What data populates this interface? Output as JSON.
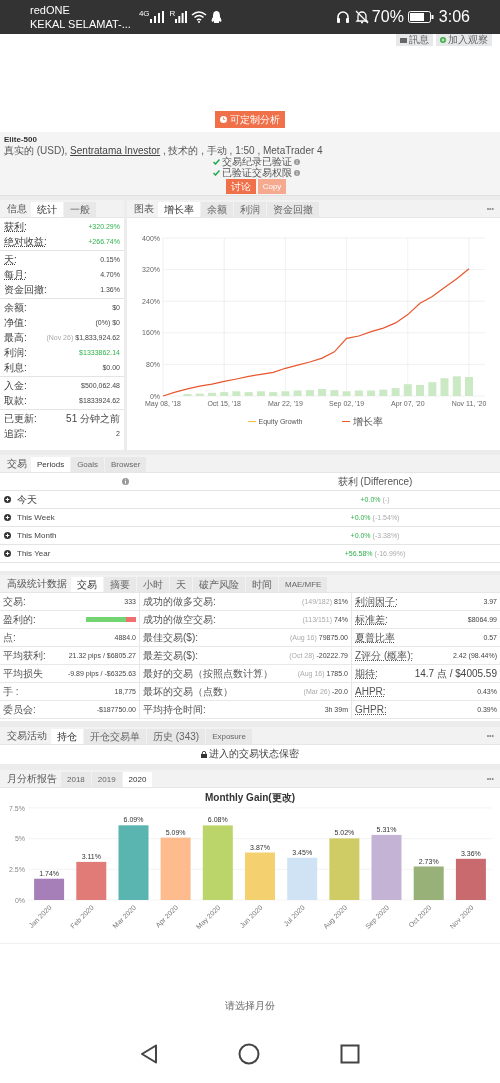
{
  "status_bar": {
    "carrier": "redONE",
    "operator": "KEKAL SELAMAT-...",
    "network_type": "4G",
    "sim2_label": "R",
    "battery": "70%",
    "time": "3:06"
  },
  "top_buttons": [
    {
      "label": "訊息"
    },
    {
      "label": "加入观察"
    }
  ],
  "analysis_button": "可定制分析",
  "account": {
    "name": "Elite-500",
    "type": "真实的 (USD),",
    "broker": "Sentratama Investor",
    "details": ", 技术的 , 手动 , 1:50 , MetaTrader 4",
    "verifications": [
      "交易纪录已验证",
      "已验证交易权限"
    ],
    "buttons": [
      {
        "label": "讨论",
        "disabled": false
      },
      {
        "label": "Copy",
        "disabled": true
      }
    ]
  },
  "stats": {
    "title": "信息",
    "tabs": [
      {
        "label": "统计",
        "selected": true
      },
      {
        "label": "一般",
        "selected": false
      }
    ],
    "groups": [
      [
        {
          "label": "获利:",
          "value": "+320.29%",
          "positive": true,
          "underlined": true
        },
        {
          "label": "绝对收益:",
          "value": "+266.74%",
          "positive": true,
          "underlined": true
        }
      ],
      [
        {
          "label": "天:",
          "value": "0.15%",
          "positive": false,
          "underlined": true
        },
        {
          "label": "每月:",
          "value": "4.70%",
          "positive": false,
          "underlined": true
        },
        {
          "label": "资金回撤:",
          "value": "1.36%",
          "positive": false,
          "underlined": false
        }
      ],
      [
        {
          "label": "余额:",
          "value": "$0",
          "positive": false,
          "underlined": false
        },
        {
          "label": "净值:",
          "value": "(0%) $0",
          "positive": false,
          "underlined": false
        },
        {
          "label": "最高:",
          "note": "(Nov 26)",
          "value": "$1,833,924.62",
          "positive": false,
          "underlined": false
        },
        {
          "label": "利润:",
          "value": "$1333862.14",
          "positive": true,
          "underlined": false
        },
        {
          "label": "利息:",
          "value": "$0.00",
          "positive": false,
          "underlined": false
        }
      ],
      [
        {
          "label": "入金:",
          "value": "$500,062.48",
          "positive": false,
          "underlined": false
        },
        {
          "label": "取款:",
          "value": "$1833924.62",
          "positive": false,
          "underlined": false
        }
      ],
      [
        {
          "label": "已更新:",
          "value": "51 分钟之前",
          "positive": false,
          "underlined": false
        },
        {
          "label": "追踪:",
          "value": "2",
          "positive": false,
          "underlined": false
        }
      ]
    ]
  },
  "growth": {
    "title": "图表",
    "tabs": [
      {
        "label": "增长率",
        "selected": true
      },
      {
        "label": "余额",
        "selected": false
      },
      {
        "label": "利润",
        "selected": false
      },
      {
        "label": "资金回撤",
        "selected": false
      }
    ],
    "menu": "•••",
    "chart_data": {
      "type": "line",
      "grid": true,
      "categories": [
        "May 08, '18",
        null,
        null,
        null,
        null,
        "Oct 15, '18",
        null,
        null,
        null,
        null,
        "Mar 22, '19",
        null,
        null,
        null,
        null,
        "Sep 02, '19",
        null,
        null,
        null,
        null,
        "Apr 07, '20",
        null,
        null,
        null,
        null,
        "Nov 11, '20"
      ],
      "ylim": [
        0,
        400
      ],
      "yticks": [
        {
          "value": 0,
          "label": "0%"
        },
        {
          "value": 80,
          "label": "80%"
        },
        {
          "value": 160,
          "label": "160%"
        },
        {
          "value": 240,
          "label": "240%"
        },
        {
          "value": 320,
          "label": "320%"
        },
        {
          "value": 400,
          "label": "400%"
        }
      ],
      "series": [
        {
          "type": "bar",
          "color": "#cbe9c4",
          "values": [
            null,
            null,
            5,
            6,
            8,
            10,
            12,
            10,
            12,
            10,
            12,
            14,
            15,
            18,
            15,
            12,
            14,
            14,
            16,
            20,
            30,
            28,
            35,
            45,
            50,
            48
          ]
        },
        {
          "name": "Equity Growth",
          "color": "#f2c12e",
          "values": [
            null,
            null,
            null,
            null,
            null,
            null,
            null,
            null,
            null,
            null,
            null,
            null,
            null,
            null,
            null,
            null,
            null,
            null,
            null,
            null,
            null,
            null,
            null,
            null,
            null,
            null
          ]
        },
        {
          "name": "增长率",
          "color": "#e8562e",
          "values": [
            0,
            10,
            18,
            25,
            30,
            37,
            43,
            50,
            55,
            60,
            70,
            78,
            86,
            96,
            112,
            146,
            152,
            163,
            172,
            185,
            206,
            235,
            252,
            275,
            297,
            322
          ]
        }
      ]
    }
  },
  "periods": {
    "title": "交易",
    "tabs": [
      {
        "label": "Periods",
        "selected": true
      },
      {
        "label": "Goals",
        "selected": false
      },
      {
        "label": "Browser",
        "selected": false
      }
    ],
    "column": "获利 (Difference)",
    "rows": [
      {
        "label": "今天",
        "gain": "+0.0%",
        "difference": "(-)"
      },
      {
        "label": "This Week",
        "gain": "+0.0%",
        "difference": "(-1.54%)"
      },
      {
        "label": "This Month",
        "gain": "+0.0%",
        "difference": "(-3.38%)"
      },
      {
        "label": "This Year",
        "gain": "+56.58%",
        "difference": "(-16.99%)"
      }
    ]
  },
  "advanced": {
    "title": "高级统计数据",
    "tabs": [
      {
        "label": "交易",
        "selected": true
      },
      {
        "label": "摘要",
        "selected": false
      },
      {
        "label": "小时",
        "selected": false
      },
      {
        "label": "天",
        "selected": false
      },
      {
        "label": "破产风险",
        "selected": false
      },
      {
        "label": "时间",
        "selected": false
      },
      {
        "label": "MAE/MFE",
        "selected": false
      }
    ],
    "rows": [
      [
        {
          "kind": "text",
          "label": "交易:",
          "value": "333",
          "underlined": false
        },
        {
          "kind": "text",
          "label": "成功的做多交易:",
          "note": "(149/182)",
          "value": "81%",
          "underlined": false
        },
        {
          "kind": "text",
          "label": "利润因子:",
          "value": "3.97",
          "underlined": true
        }
      ],
      [
        {
          "kind": "bar",
          "label": "盈利的:",
          "level": 0.79,
          "underlined": false
        },
        {
          "kind": "text",
          "label": "成功的做空交易:",
          "note": "(113/151)",
          "value": "74%",
          "underlined": false
        },
        {
          "kind": "text",
          "label": "标准差:",
          "value": "$8064.99",
          "underlined": true
        }
      ],
      [
        {
          "kind": "text",
          "label": "点:",
          "value": "4884.0",
          "underlined": false
        },
        {
          "kind": "text",
          "label": "最佳交易($):",
          "note": "(Aug 16)",
          "value": "79875.00",
          "underlined": false
        },
        {
          "kind": "text",
          "label": "夏普比率",
          "value": "0.57",
          "underlined": true
        }
      ],
      [
        {
          "kind": "text",
          "label": "平均获利:",
          "value": "21.32 pips / $6805.27",
          "underlined": false
        },
        {
          "kind": "text",
          "label": "最差交易($):",
          "note": "(Oct 28)",
          "value": "-20222.79",
          "underlined": false
        },
        {
          "kind": "text",
          "label": "Z评分 (概率):",
          "value": "2.42 (98.44%)",
          "underlined": true
        }
      ],
      [
        {
          "kind": "text",
          "label": "平均损失",
          "value": "-9.89 pips / -$6325.63",
          "underlined": false
        },
        {
          "kind": "text",
          "label": "最好的交易（按照点数计算）",
          "note": "(Aug 16)",
          "value": "1785.0",
          "underlined": false
        },
        {
          "kind": "text",
          "label": "期待:",
          "value": "14.7 点 / $4005.59",
          "underlined": true
        }
      ],
      [
        {
          "kind": "text",
          "label": "手 :",
          "value": "18,775",
          "underlined": false
        },
        {
          "kind": "text",
          "label": "最坏的交易（点数）",
          "note": "(Mar 26)",
          "value": "-20.0",
          "underlined": false
        },
        {
          "kind": "text",
          "label": "AHPR:",
          "value": "0.43%",
          "underlined": true
        }
      ],
      [
        {
          "kind": "text",
          "label": "委员会:",
          "value": "-$187750.00",
          "underlined": false
        },
        {
          "kind": "text",
          "label": "平均持仓时间:",
          "value": "3h 39m",
          "underlined": false
        },
        {
          "kind": "text",
          "label": "GHPR:",
          "value": "0.39%",
          "underlined": true
        }
      ]
    ]
  },
  "activity": {
    "title": "交易活动",
    "tabs": [
      {
        "label": "持仓",
        "selected": true
      },
      {
        "label": "开仓交易单",
        "selected": false
      },
      {
        "label": "历史 (343)",
        "selected": false
      },
      {
        "label": "Exposure",
        "selected": false
      }
    ],
    "menu": "•••",
    "message": "进入的交易状态保密"
  },
  "monthly": {
    "title": "月分析报告",
    "tabs": [
      {
        "label": "2018",
        "selected": false
      },
      {
        "label": "2019",
        "selected": false
      },
      {
        "label": "2020",
        "selected": true
      }
    ],
    "menu": "•••",
    "bars": [
      {
        "color": "#a67fb9"
      },
      {
        "color": "#e07b77"
      },
      {
        "color": "#5ab4b0"
      },
      {
        "color": "#fdbb8e"
      },
      {
        "color": "#bcd56a"
      },
      {
        "color": "#f4d06f"
      },
      {
        "color": "#cfe3f5"
      },
      {
        "color": "#cfcb65"
      },
      {
        "color": "#c5b3d6"
      },
      {
        "color": "#97b179"
      },
      {
        "color": "#c96a6f"
      }
    ],
    "chart_data": {
      "type": "bar",
      "title": "Monthly Gain(更改)",
      "categories": [
        "Jan 2020",
        "Feb 2020",
        "Mar 2020",
        "Apr 2020",
        "May 2020",
        "Jun 2020",
        "Jul 2020",
        "Aug 2020",
        "Sep 2020",
        "Oct 2020",
        "Nov 2020"
      ],
      "series": [
        {
          "values": [
            1.74,
            3.11,
            6.09,
            5.09,
            6.08,
            3.87,
            3.45,
            5.02,
            5.31,
            2.73,
            3.36
          ]
        }
      ],
      "ylim": [
        0,
        7.5
      ],
      "yticks": [
        {
          "value": 0,
          "label": "0%"
        },
        {
          "value": 2.5,
          "label": "2.5%"
        },
        {
          "value": 5,
          "label": "5%"
        },
        {
          "value": 7.5,
          "label": "7.5%"
        }
      ],
      "value_labels": [
        "1.74%",
        "3.11%",
        "6.09%",
        "5.09%",
        "6.08%",
        "3.87%",
        "3.45%",
        "5.02%",
        "5.31%",
        "2.73%",
        "3.36%"
      ]
    },
    "prompt": "请选择月份"
  }
}
